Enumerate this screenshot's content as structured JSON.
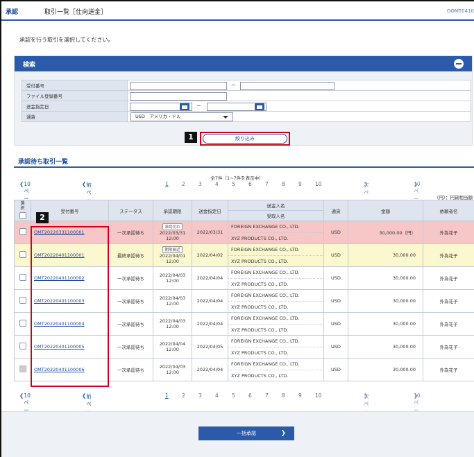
{
  "header": {
    "screen_kind": "承認",
    "title": "取引一覧［仕向送金］",
    "screen_id": "GOMT0410"
  },
  "instruction": "承認を行う取引を選択してください。",
  "search": {
    "title": "検索",
    "fields": [
      {
        "label": "受付番号"
      },
      {
        "label": "ファイル登録番号"
      },
      {
        "label": "送金指定日"
      },
      {
        "label": "通貨",
        "value": "USD　アメリカ・ドル"
      }
    ],
    "narrow_label": "絞り込み",
    "badge": "1"
  },
  "list": {
    "title": "承認待ち取引一覧",
    "count_text": "全7件（1~7件を表示中）",
    "pager": {
      "prev10": "10ページ前",
      "prev": "前ページ",
      "pages": [
        "1",
        "2",
        "3",
        "4",
        "5",
        "6",
        "7",
        "8",
        "9",
        "10"
      ],
      "next": "次ページ",
      "next10": "10ページ次"
    },
    "unit": "（円）：円貨相当額",
    "badge": "2",
    "headers": {
      "select": "選択",
      "receipt_no": "受付番号",
      "status": "ステータス",
      "deadline": "承認期限",
      "send_date": "送金指定日",
      "remitter": "送金人名",
      "beneficiary": "受取人名",
      "currency": "通貨",
      "amount": "金額",
      "requester": "依頼者名"
    },
    "rows": [
      {
        "no": "OMT20220331100001",
        "status": "一次承認待ち",
        "tag": "承認切れ",
        "deadline_date": "2022/03/31",
        "deadline_time": "12:00",
        "send_date": "2022/03/31",
        "remitter": "FOREIGN EXCHANGE CO., LTD.",
        "beneficiary": "XYZ PRODUCTS CO., LTD.",
        "currency": "USD",
        "amount": "30,000.00（円）",
        "requester": "外為花子"
      },
      {
        "no": "OMT20220401100001",
        "status": "最終承認待ち",
        "tag": "期限間近",
        "deadline_date": "2022/04/01",
        "deadline_time": "12:00",
        "send_date": "2022/04/02",
        "remitter": "FOREIGN EXCHANGE CO., LTD.",
        "beneficiary": "XYZ PRODUCTS CO., LTD.",
        "currency": "USD",
        "amount": "30,000.00",
        "requester": "外為花子"
      },
      {
        "no": "OMT20220401100002",
        "status": "一次承認待ち",
        "tag": "",
        "deadline_date": "2022/04/03",
        "deadline_time": "12:00",
        "send_date": "2022/04/04",
        "remitter": "FOREIGN EXCHANGE CO., LTD.",
        "beneficiary": "XYZ PRODUCTS CO., LTD.",
        "currency": "USD",
        "amount": "30,000.00",
        "requester": "外為花子"
      },
      {
        "no": "OMT20220401100003",
        "status": "一次承認待ち",
        "tag": "",
        "deadline_date": "2022/04/03",
        "deadline_time": "12:00",
        "send_date": "2022/04/04",
        "remitter": "FOREIGN EXCHANGE CO., LTD.",
        "beneficiary": "XYZ PRODUCTS CO., LTD.",
        "currency": "USD",
        "amount": "30,000.00",
        "requester": "外為花子"
      },
      {
        "no": "OMT20220401100004",
        "status": "一次承認待ち",
        "tag": "",
        "deadline_date": "2022/04/03",
        "deadline_time": "12:00",
        "send_date": "2022/04/04",
        "remitter": "FOREIGN EXCHANGE CO., LTD.",
        "beneficiary": "XYZ PRODUCTS CO., LTD.",
        "currency": "USD",
        "amount": "30,000.00",
        "requester": "外為花子"
      },
      {
        "no": "OMT20220401100005",
        "status": "一次承認待ち",
        "tag": "",
        "deadline_date": "2022/04/04",
        "deadline_time": "12:00",
        "send_date": "2022/04/05",
        "remitter": "FOREIGN EXCHANGE CO., LTD.",
        "beneficiary": "XYZ PRODUCTS CO., LTD.",
        "currency": "USD",
        "amount": "30,000.00",
        "requester": "外為花子"
      },
      {
        "no": "OMT20220401100006",
        "status": "一次承認待ち",
        "tag": "",
        "deadline_date": "2022/04/03",
        "deadline_time": "12:00",
        "send_date": "2022/04/04",
        "remitter": "FOREIGN EXCHANGE CO., LTD.",
        "beneficiary": "XYZ PRODUCTS CO., LTD.",
        "currency": "USD",
        "amount": "30,000.00",
        "requester": "外為花子"
      }
    ]
  },
  "footer": {
    "bulk_approve_label": "一括承認"
  }
}
